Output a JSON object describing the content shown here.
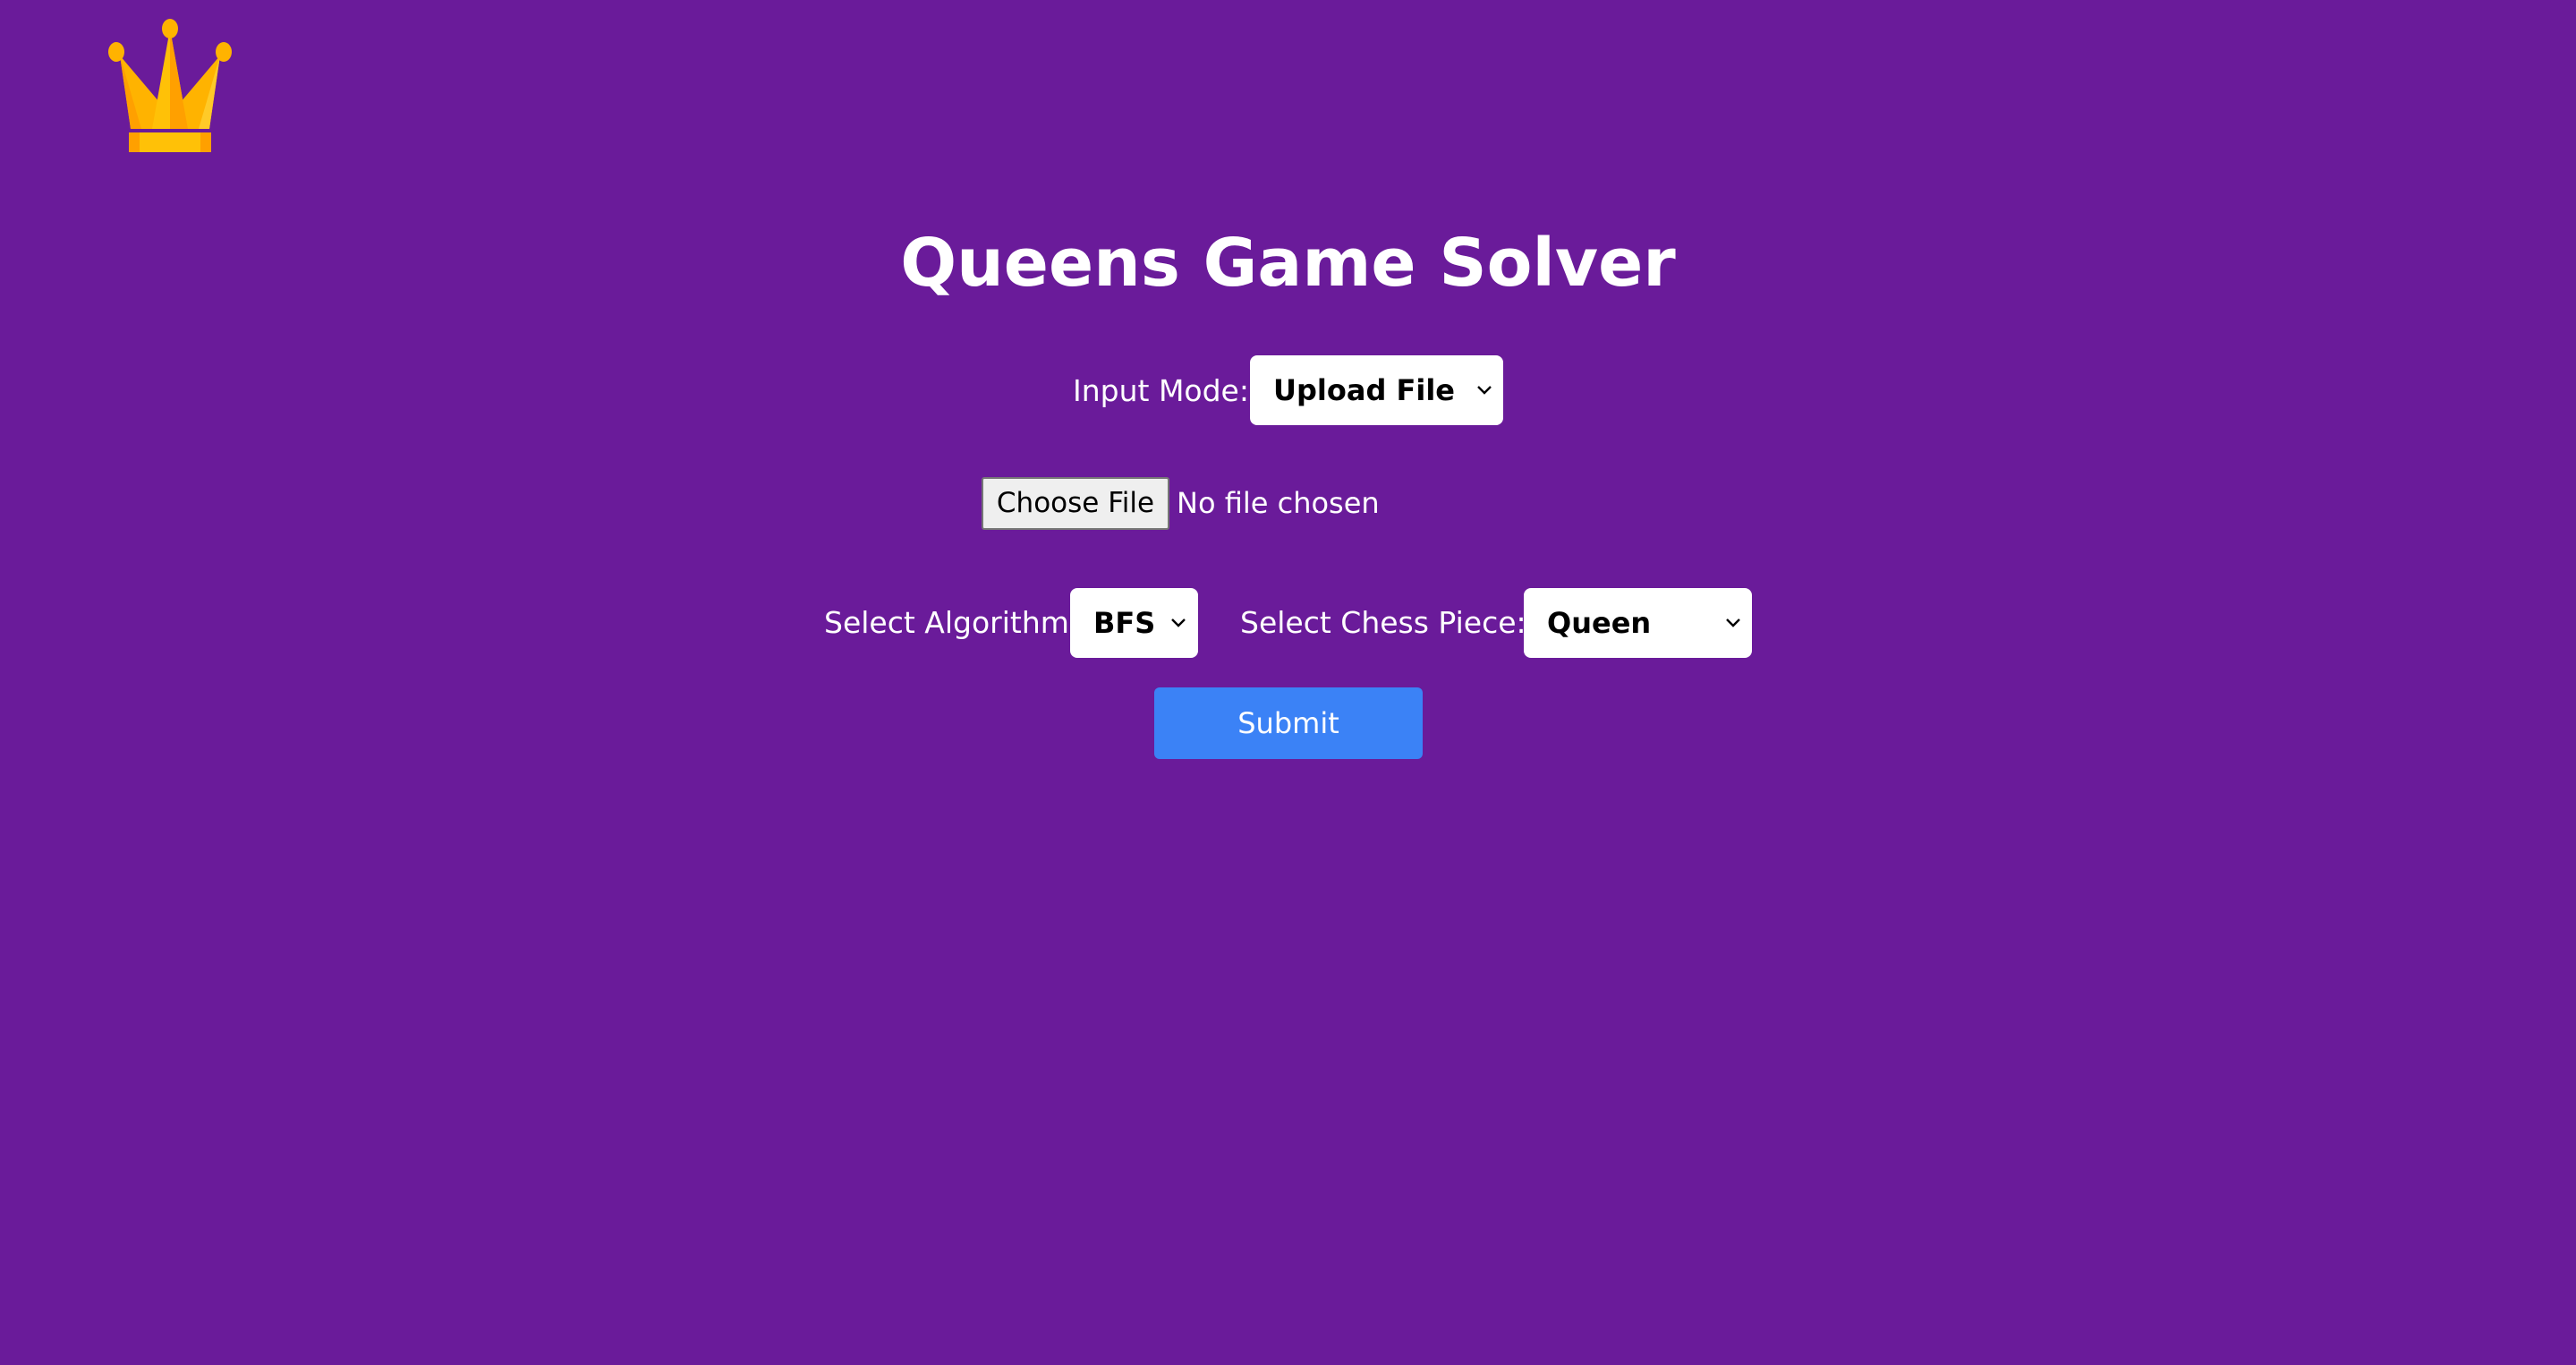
{
  "app": {
    "title": "Queens Game Solver",
    "logo_icon": "crown-icon"
  },
  "colors": {
    "background": "#6a1b9a",
    "accent": "#3b82f6",
    "logo": "#ffc107"
  },
  "input_mode": {
    "label": "Input Mode:",
    "selected": "Upload File"
  },
  "file_upload": {
    "button_label": "Choose File",
    "status": "No file chosen"
  },
  "algorithm": {
    "label": "Select Algorithm:",
    "selected": "BFS"
  },
  "chess_piece": {
    "label": "Select Chess Piece:",
    "selected": "Queen"
  },
  "submit": {
    "label": "Submit"
  }
}
